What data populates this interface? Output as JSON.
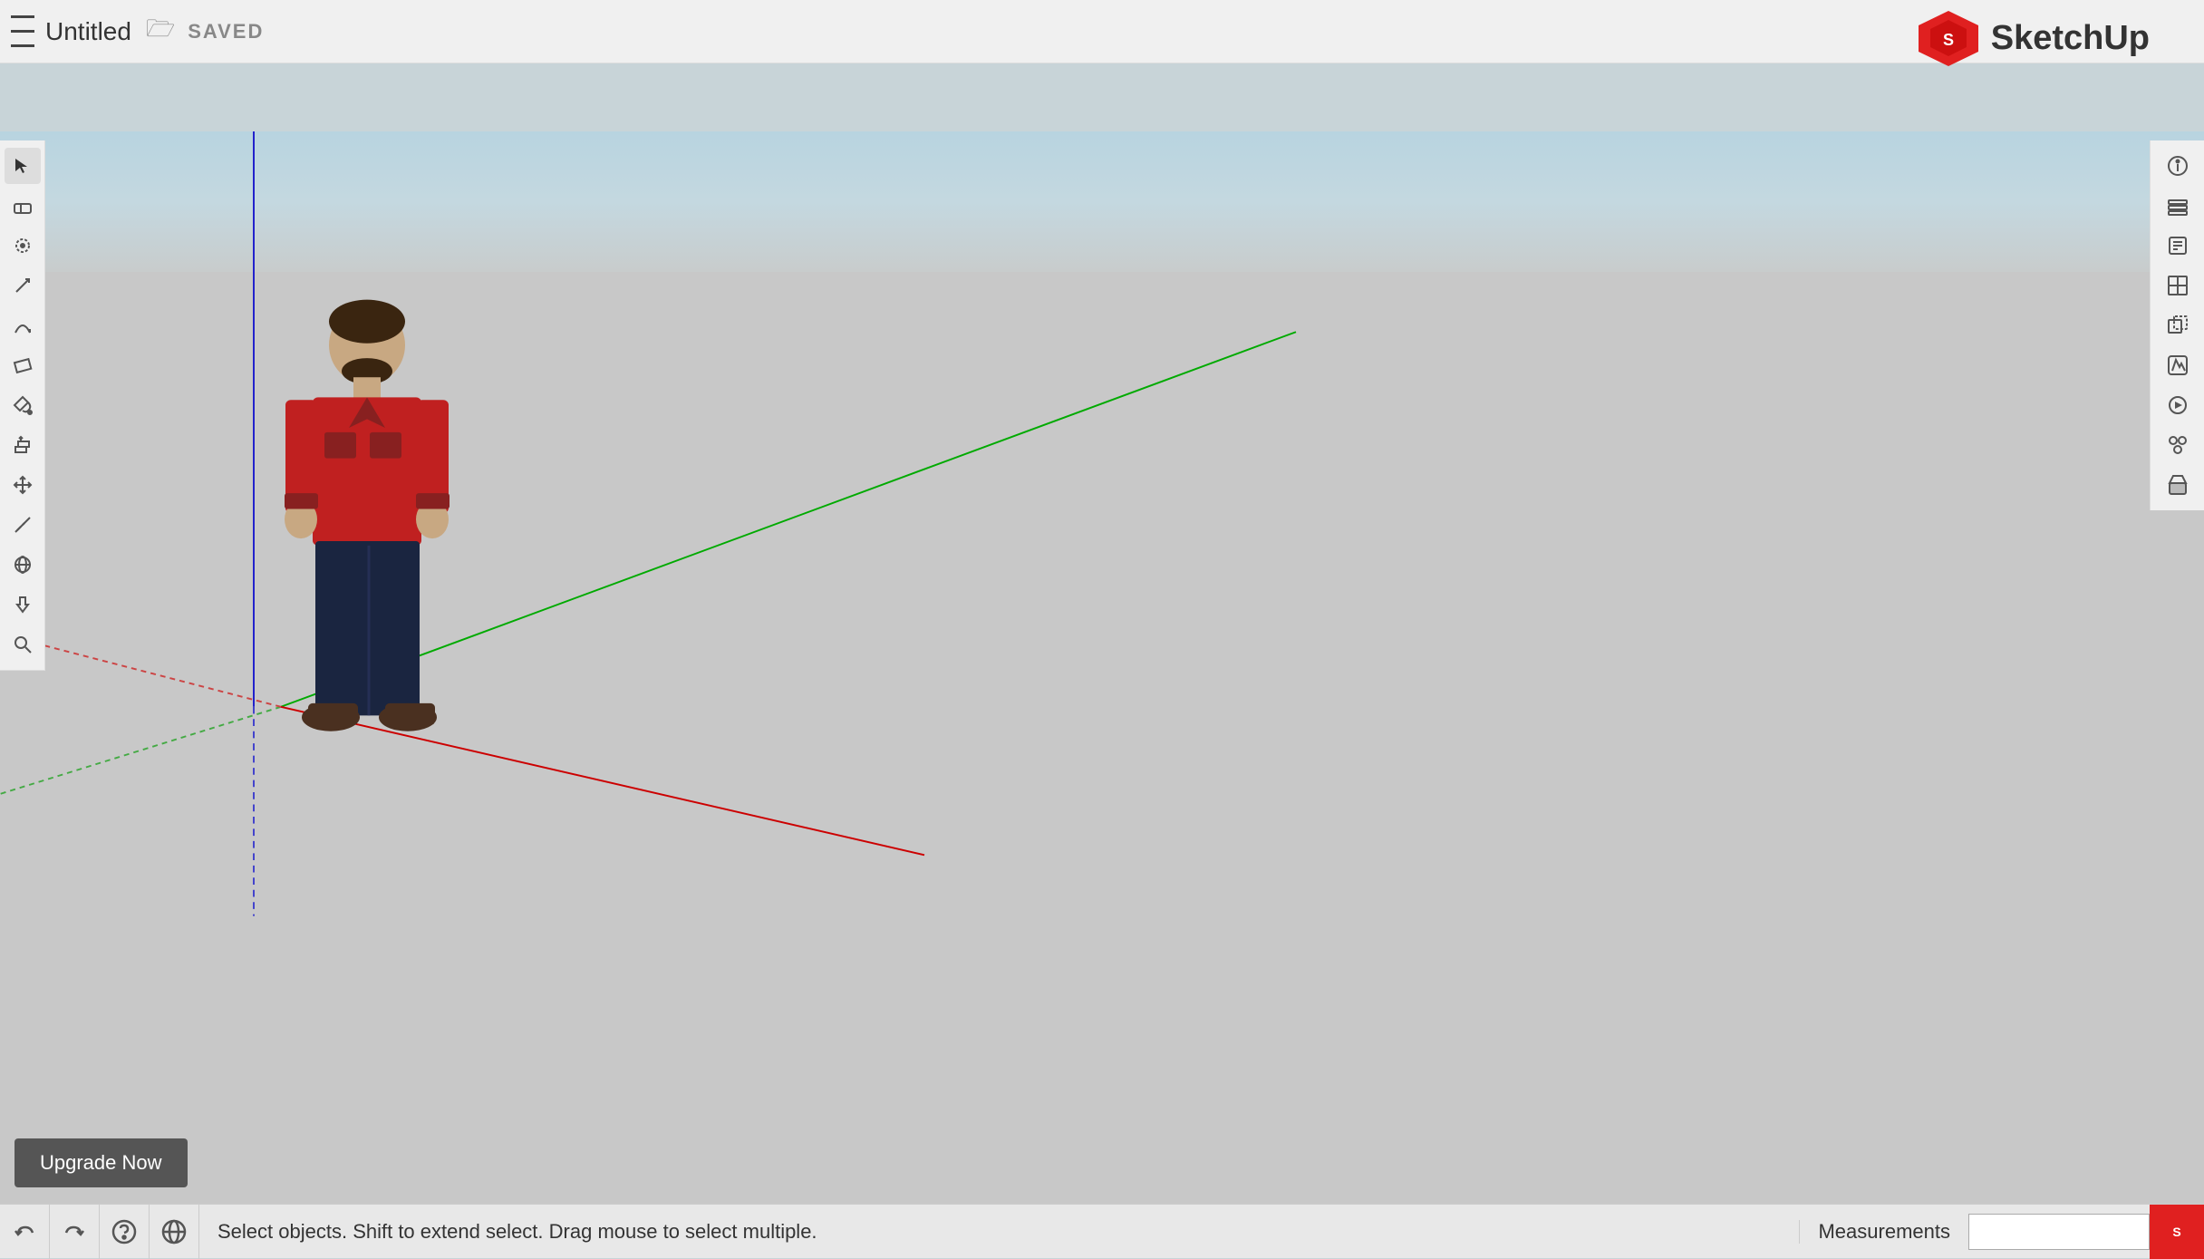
{
  "titlebar": {
    "title": "Untitled",
    "saved_status": "SAVED"
  },
  "logo": {
    "name": "SketchUp"
  },
  "left_toolbar": {
    "tools": [
      {
        "name": "select",
        "label": "Select",
        "active": true
      },
      {
        "name": "eraser",
        "label": "Eraser"
      },
      {
        "name": "lasso",
        "label": "Lasso Select"
      },
      {
        "name": "line",
        "label": "Line"
      },
      {
        "name": "arc",
        "label": "Arc"
      },
      {
        "name": "rectangle",
        "label": "Rectangle"
      },
      {
        "name": "paint-bucket",
        "label": "Paint Bucket"
      },
      {
        "name": "push-pull",
        "label": "Push/Pull"
      },
      {
        "name": "move",
        "label": "Move"
      },
      {
        "name": "tape-measure",
        "label": "Tape Measure"
      },
      {
        "name": "orbit",
        "label": "Orbit"
      },
      {
        "name": "pan",
        "label": "Pan"
      },
      {
        "name": "zoom",
        "label": "Zoom"
      }
    ]
  },
  "right_toolbar": {
    "panels": [
      {
        "name": "entity-info",
        "label": "Entity Info"
      },
      {
        "name": "layers",
        "label": "Layers"
      },
      {
        "name": "instructor",
        "label": "Instructor"
      },
      {
        "name": "components",
        "label": "Components"
      },
      {
        "name": "solid-tools",
        "label": "Solid Tools"
      },
      {
        "name": "styles",
        "label": "Styles"
      },
      {
        "name": "scenes",
        "label": "Scenes"
      },
      {
        "name": "outliner",
        "label": "Outliner"
      },
      {
        "name": "shadow",
        "label": "Shadow"
      }
    ]
  },
  "statusbar": {
    "hint_text": "Select objects. Shift to extend select. Drag mouse to select multiple.",
    "measurements_label": "Measurements",
    "undo_label": "Undo",
    "redo_label": "Redo",
    "help_label": "Help",
    "location_label": "Model Info"
  },
  "upgrade_button": {
    "label": "Upgrade Now"
  },
  "axis_colors": {
    "blue": "#0000cc",
    "red": "#cc0000",
    "green": "#00aa00",
    "blue_dashed": "#4444cc",
    "red_dashed": "#cc4444",
    "green_dashed": "#44aa44"
  }
}
